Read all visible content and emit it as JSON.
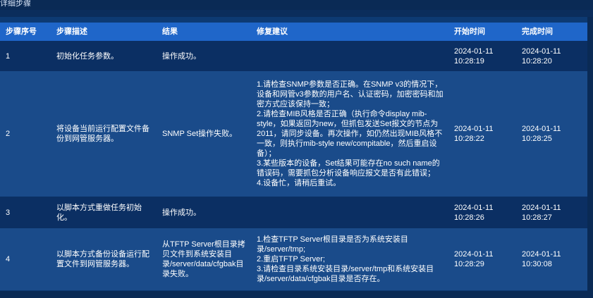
{
  "section_title": "详细步骤",
  "table": {
    "headers": {
      "seq": "步骤序号",
      "desc": "步骤描述",
      "result": "结果",
      "fix": "修复建议",
      "start": "开始时间",
      "end": "完成时间"
    },
    "rows": [
      {
        "seq": "1",
        "desc": "初始化任务参数。",
        "result": "操作成功。",
        "fix": [],
        "start_date": "2024-01-11",
        "start_time": "10:28:19",
        "end_date": "2024-01-11",
        "end_time": "10:28:20"
      },
      {
        "seq": "2",
        "desc": "将设备当前运行配置文件备份到网管服务器。",
        "result": "SNMP Set操作失败。",
        "fix": [
          "1.请检查SNMP参数是否正确。在SNMP v3的情况下，设备和网管v3参数的用户名、认证密码，加密密码和加密方式应该保持一致；",
          "2.请检查MIB风格是否正确（执行命令display mib-style，如果返回为new，但抓包发送Set报文的节点为2011，请同步设备。再次操作，如仍然出现MIB风格不一致，则执行mib-style new/compitable，然后重启设备）；",
          "3.某些版本的设备，Set结果可能存在no such name的错误码，需要抓包分析设备响应报文是否有此错误；",
          "4.设备忙，请稍后重试。"
        ],
        "start_date": "2024-01-11",
        "start_time": "10:28:22",
        "end_date": "2024-01-11",
        "end_time": "10:28:25"
      },
      {
        "seq": "3",
        "desc": "以脚本方式重做任务初始化。",
        "result": "操作成功。",
        "fix": [],
        "start_date": "2024-01-11",
        "start_time": "10:28:26",
        "end_date": "2024-01-11",
        "end_time": "10:28:27"
      },
      {
        "seq": "4",
        "desc": "以脚本方式备份设备运行配置文件到网管服务器。",
        "result": "从TFTP Server根目录拷贝文件到系统安装目录/server/data/cfgbak目录失败。",
        "fix": [
          "1.检查TFTP Server根目录是否为系统安装目录/server/tmp;",
          "2.重启TFTP Server;",
          "3.请检查目录系统安装目录/server/tmp和系统安装目录/server/data/cfgbak目录是否存在。"
        ],
        "start_date": "2024-01-11",
        "start_time": "10:28:29",
        "end_date": "2024-01-11",
        "end_time": "10:30:08"
      }
    ]
  }
}
